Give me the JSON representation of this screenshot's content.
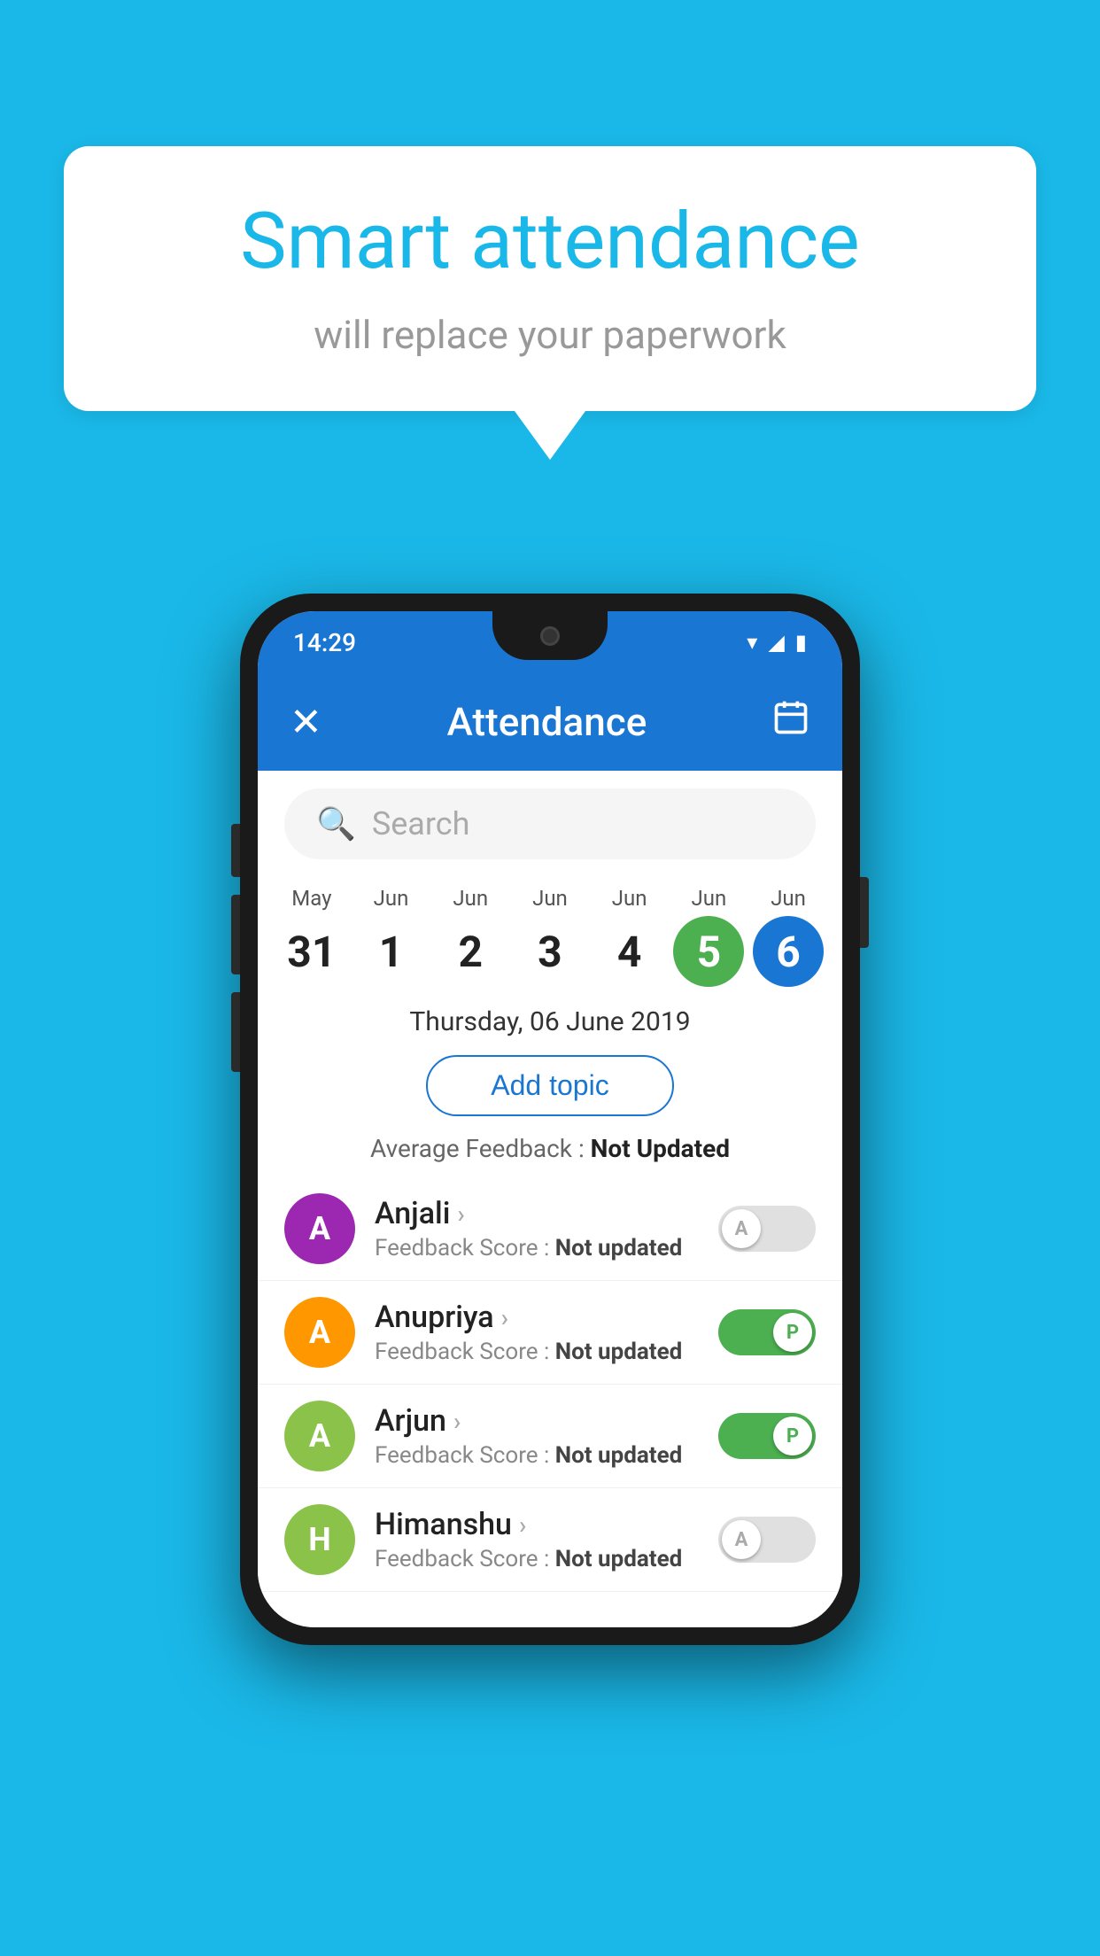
{
  "background_color": "#1ab8e8",
  "bubble": {
    "title": "Smart attendance",
    "subtitle": "will replace your paperwork"
  },
  "phone": {
    "status_time": "14:29",
    "toolbar": {
      "title": "Attendance",
      "close_icon": "✕",
      "calendar_icon": "📅"
    },
    "search": {
      "placeholder": "Search"
    },
    "calendar": {
      "days": [
        {
          "month": "May",
          "date": "31",
          "state": "normal"
        },
        {
          "month": "Jun",
          "date": "1",
          "state": "normal"
        },
        {
          "month": "Jun",
          "date": "2",
          "state": "normal"
        },
        {
          "month": "Jun",
          "date": "3",
          "state": "normal"
        },
        {
          "month": "Jun",
          "date": "4",
          "state": "normal"
        },
        {
          "month": "Jun",
          "date": "5",
          "state": "today"
        },
        {
          "month": "Jun",
          "date": "6",
          "state": "selected"
        }
      ]
    },
    "selected_date_label": "Thursday, 06 June 2019",
    "add_topic_label": "Add topic",
    "avg_feedback_prefix": "Average Feedback : ",
    "avg_feedback_value": "Not Updated",
    "students": [
      {
        "name": "Anjali",
        "avatar_letter": "A",
        "avatar_color": "#9c27b0",
        "feedback_label": "Feedback Score : ",
        "feedback_value": "Not updated",
        "attendance": "absent",
        "toggle_letter": "A"
      },
      {
        "name": "Anupriya",
        "avatar_letter": "A",
        "avatar_color": "#ff9800",
        "feedback_label": "Feedback Score : ",
        "feedback_value": "Not updated",
        "attendance": "present",
        "toggle_letter": "P"
      },
      {
        "name": "Arjun",
        "avatar_letter": "A",
        "avatar_color": "#8bc34a",
        "feedback_label": "Feedback Score : ",
        "feedback_value": "Not updated",
        "attendance": "present",
        "toggle_letter": "P"
      },
      {
        "name": "Himanshu",
        "avatar_letter": "H",
        "avatar_color": "#8bc34a",
        "feedback_label": "Feedback Score : ",
        "feedback_value": "Not updated",
        "attendance": "absent",
        "toggle_letter": "A"
      }
    ]
  }
}
